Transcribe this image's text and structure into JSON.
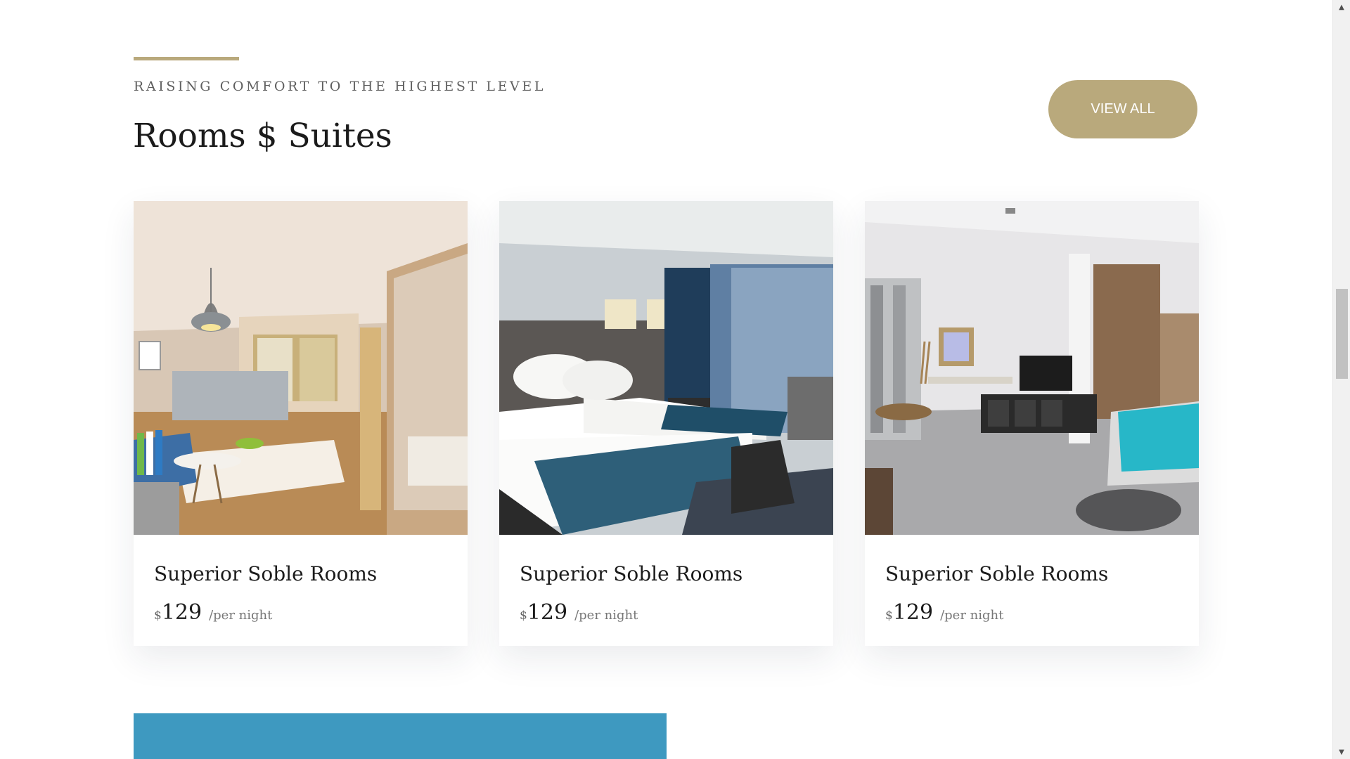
{
  "section": {
    "eyebrow": "RAISING COMFORT TO THE HIGHEST LEVEL",
    "title": "Rooms $ Suites",
    "view_all_label": "VIEW ALL"
  },
  "rooms": [
    {
      "title": "Superior Soble Rooms",
      "currency": "$",
      "price": "129",
      "per_night": "/per night",
      "image_icon": "warm-wood-hotel-room-photo"
    },
    {
      "title": "Superior Soble Rooms",
      "currency": "$",
      "price": "129",
      "per_night": "/per night",
      "image_icon": "twin-bed-hotel-room-photo"
    },
    {
      "title": "Superior Soble Rooms",
      "currency": "$",
      "price": "129",
      "per_night": "/per night",
      "image_icon": "modern-suite-with-tv-photo"
    }
  ],
  "colors": {
    "accent_gold": "#b9a97c",
    "accent_blue": "#3e99c0",
    "heading_text": "#1b1b1b",
    "muted_text": "#5f5f5f"
  },
  "scrollbar": {
    "thumb_position_fraction": 0.41
  }
}
